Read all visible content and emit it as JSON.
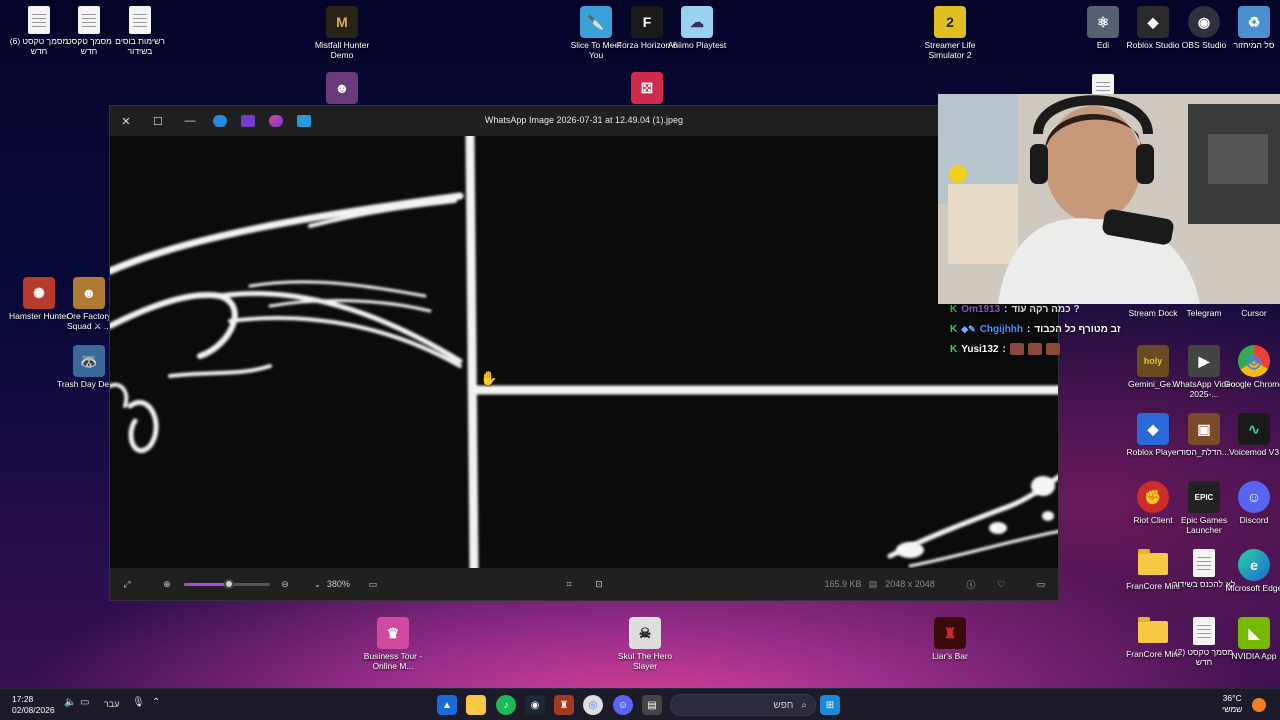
{
  "desktop_icons_left": [
    {
      "id": "doc6",
      "label": "מסמך טקסט (6) חדש",
      "type": "doc"
    },
    {
      "id": "doc-new",
      "label": "מסמך טקסט חדש",
      "type": "doc"
    },
    {
      "id": "list",
      "label": "רשימות בוסים בשידור",
      "type": "doc"
    },
    {
      "id": "mistfall",
      "label": "Mistfall Hunter Demo",
      "type": "app",
      "color": "#2a2418",
      "glyph": "M"
    },
    {
      "id": "hamster",
      "label": "Hamster Hunter",
      "type": "app",
      "color": "#b83a2a",
      "glyph": "✺"
    },
    {
      "id": "ore",
      "label": "Ore Factory Squad ⚔ ...",
      "type": "app",
      "color": "#b07a30",
      "glyph": "☻"
    },
    {
      "id": "trash",
      "label": "Trash Day Demo",
      "type": "app",
      "color": "#3a6a9a",
      "glyph": "🦝"
    }
  ],
  "desktop_icons_top": [
    {
      "id": "slice",
      "label": "Slice To Meet You",
      "color": "#3aa0d8",
      "glyph": "🔪"
    },
    {
      "id": "forza",
      "label": "Forza Horizon 6",
      "color": "#1a1a1a",
      "glyph": "F"
    },
    {
      "id": "aniimo",
      "label": "Aniimo Playtest",
      "color": "#9ad0f0",
      "glyph": "☁"
    },
    {
      "id": "streamer",
      "label": "Streamer Life Simulator 2",
      "color": "#e0c020",
      "glyph": "2"
    }
  ],
  "desktop_icons_right": [
    {
      "id": "edi",
      "label": "Edi",
      "color": "#556070",
      "glyph": "⚛"
    },
    {
      "id": "roblox-studio",
      "label": "Roblox Studio",
      "color": "#2a2a2a",
      "glyph": "◆"
    },
    {
      "id": "obs",
      "label": "OBS Studio",
      "color": "#303040",
      "glyph": "◉"
    },
    {
      "id": "recycle",
      "label": "סל המיחזור",
      "color": "#4a90d0",
      "glyph": "♻"
    },
    {
      "id": "stream-dock",
      "label": "Stream Dock",
      "color": "#1a1a2a",
      "glyph": ""
    },
    {
      "id": "telegram",
      "label": "Telegram",
      "color": "#2aa0e0",
      "glyph": ""
    },
    {
      "id": "cursor",
      "label": "Cursor",
      "color": "#222",
      "glyph": ""
    },
    {
      "id": "gemini",
      "label": "Gemini_Ge...",
      "color": "#6a4a20",
      "glyph": "holy"
    },
    {
      "id": "whatsapp-video",
      "label": "WhatsApp Video 2025-...",
      "color": "#444",
      "glyph": "▶"
    },
    {
      "id": "chrome",
      "label": "Google Chrome",
      "color": "#e0e0e0",
      "glyph": "◎"
    },
    {
      "id": "roblox-player",
      "label": "Roblox Player",
      "color": "#2a6ad8",
      "glyph": "◆"
    },
    {
      "id": "hebrew-file",
      "label": "הדלת_הסוד...",
      "color": "#7a4a2a",
      "glyph": "▣"
    },
    {
      "id": "voicemod",
      "label": "Voicemod V3",
      "color": "#1a1a1a",
      "glyph": "∿"
    },
    {
      "id": "riot",
      "label": "Riot Client",
      "color": "#d02a2a",
      "glyph": "✊"
    },
    {
      "id": "epic",
      "label": "Epic Games Launcher",
      "color": "#222",
      "glyph": "EPIC"
    },
    {
      "id": "discord",
      "label": "Discord",
      "color": "#5865f2",
      "glyph": "☺"
    },
    {
      "id": "francore1",
      "label": "FranCore Mini",
      "type": "folder"
    },
    {
      "id": "nolive",
      "label": "לא להכנס בשידור",
      "type": "doc"
    },
    {
      "id": "edge",
      "label": "Microsoft Edge",
      "color": "#1a8ad8",
      "glyph": "e"
    },
    {
      "id": "francore2",
      "label": "FranCore Mini",
      "type": "folder"
    },
    {
      "id": "doc2",
      "label": "מסמך טקסט (2) חדש",
      "type": "doc"
    },
    {
      "id": "nvidia",
      "label": "NVIDIA App",
      "color": "#76b900",
      "glyph": "◣"
    }
  ],
  "desktop_icons_bottom": [
    {
      "id": "business",
      "label": "Business Tour - Online M...",
      "color": "#d04aa0",
      "glyph": "♛"
    },
    {
      "id": "skul",
      "label": "Skul The Hero Slayer",
      "color": "#ddd",
      "glyph": "☠"
    },
    {
      "id": "liars",
      "label": "Liar's Bar",
      "color": "#3a0a0a",
      "glyph": "♜"
    }
  ],
  "photos_window": {
    "title": "WhatsApp Image 2026-07-31 at 12.49.04 (1).jpeg",
    "zoom_level": "380%",
    "zoom_fraction": 0.52,
    "file_size": "165.9 KB",
    "dimensions": "2048 x 2048",
    "more_label": "⋯"
  },
  "chat": [
    {
      "user": "Om1913",
      "message": "כמה רקה עוד ?",
      "color": "#a060e0"
    },
    {
      "user": "Chgijhhh",
      "message": "זב מטורף כל הכבוד",
      "color": "#4a90ff"
    },
    {
      "user": "Yusi132",
      "message": "",
      "color": "#ffffff",
      "emotes": 3
    }
  ],
  "taskbar": {
    "time": "17:28",
    "date": "02/08/2026",
    "language": "עבר",
    "search_placeholder": "חפש",
    "temperature": "36°C",
    "weather_text": "שמשי"
  }
}
